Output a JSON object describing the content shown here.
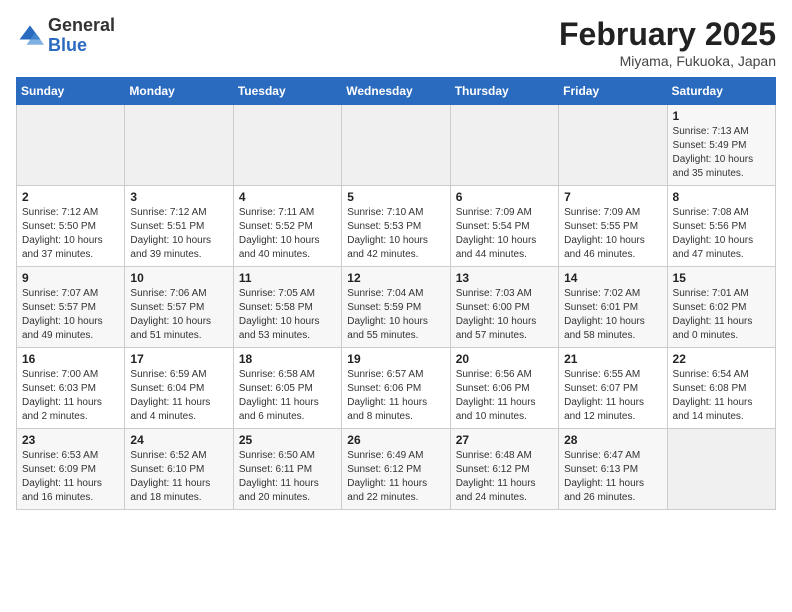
{
  "header": {
    "logo": {
      "general": "General",
      "blue": "Blue"
    },
    "title": "February 2025",
    "location": "Miyama, Fukuoka, Japan"
  },
  "days_of_week": [
    "Sunday",
    "Monday",
    "Tuesday",
    "Wednesday",
    "Thursday",
    "Friday",
    "Saturday"
  ],
  "weeks": [
    [
      {
        "day": null
      },
      {
        "day": null
      },
      {
        "day": null
      },
      {
        "day": null
      },
      {
        "day": null
      },
      {
        "day": null
      },
      {
        "day": 1,
        "sunrise": "7:13 AM",
        "sunset": "5:49 PM",
        "daylight": "10 hours and 35 minutes."
      }
    ],
    [
      {
        "day": 2,
        "sunrise": "7:12 AM",
        "sunset": "5:50 PM",
        "daylight": "10 hours and 37 minutes."
      },
      {
        "day": 3,
        "sunrise": "7:12 AM",
        "sunset": "5:51 PM",
        "daylight": "10 hours and 39 minutes."
      },
      {
        "day": 4,
        "sunrise": "7:11 AM",
        "sunset": "5:52 PM",
        "daylight": "10 hours and 40 minutes."
      },
      {
        "day": 5,
        "sunrise": "7:10 AM",
        "sunset": "5:53 PM",
        "daylight": "10 hours and 42 minutes."
      },
      {
        "day": 6,
        "sunrise": "7:09 AM",
        "sunset": "5:54 PM",
        "daylight": "10 hours and 44 minutes."
      },
      {
        "day": 7,
        "sunrise": "7:09 AM",
        "sunset": "5:55 PM",
        "daylight": "10 hours and 46 minutes."
      },
      {
        "day": 8,
        "sunrise": "7:08 AM",
        "sunset": "5:56 PM",
        "daylight": "10 hours and 47 minutes."
      }
    ],
    [
      {
        "day": 9,
        "sunrise": "7:07 AM",
        "sunset": "5:57 PM",
        "daylight": "10 hours and 49 minutes."
      },
      {
        "day": 10,
        "sunrise": "7:06 AM",
        "sunset": "5:57 PM",
        "daylight": "10 hours and 51 minutes."
      },
      {
        "day": 11,
        "sunrise": "7:05 AM",
        "sunset": "5:58 PM",
        "daylight": "10 hours and 53 minutes."
      },
      {
        "day": 12,
        "sunrise": "7:04 AM",
        "sunset": "5:59 PM",
        "daylight": "10 hours and 55 minutes."
      },
      {
        "day": 13,
        "sunrise": "7:03 AM",
        "sunset": "6:00 PM",
        "daylight": "10 hours and 57 minutes."
      },
      {
        "day": 14,
        "sunrise": "7:02 AM",
        "sunset": "6:01 PM",
        "daylight": "10 hours and 58 minutes."
      },
      {
        "day": 15,
        "sunrise": "7:01 AM",
        "sunset": "6:02 PM",
        "daylight": "11 hours and 0 minutes."
      }
    ],
    [
      {
        "day": 16,
        "sunrise": "7:00 AM",
        "sunset": "6:03 PM",
        "daylight": "11 hours and 2 minutes."
      },
      {
        "day": 17,
        "sunrise": "6:59 AM",
        "sunset": "6:04 PM",
        "daylight": "11 hours and 4 minutes."
      },
      {
        "day": 18,
        "sunrise": "6:58 AM",
        "sunset": "6:05 PM",
        "daylight": "11 hours and 6 minutes."
      },
      {
        "day": 19,
        "sunrise": "6:57 AM",
        "sunset": "6:06 PM",
        "daylight": "11 hours and 8 minutes."
      },
      {
        "day": 20,
        "sunrise": "6:56 AM",
        "sunset": "6:06 PM",
        "daylight": "11 hours and 10 minutes."
      },
      {
        "day": 21,
        "sunrise": "6:55 AM",
        "sunset": "6:07 PM",
        "daylight": "11 hours and 12 minutes."
      },
      {
        "day": 22,
        "sunrise": "6:54 AM",
        "sunset": "6:08 PM",
        "daylight": "11 hours and 14 minutes."
      }
    ],
    [
      {
        "day": 23,
        "sunrise": "6:53 AM",
        "sunset": "6:09 PM",
        "daylight": "11 hours and 16 minutes."
      },
      {
        "day": 24,
        "sunrise": "6:52 AM",
        "sunset": "6:10 PM",
        "daylight": "11 hours and 18 minutes."
      },
      {
        "day": 25,
        "sunrise": "6:50 AM",
        "sunset": "6:11 PM",
        "daylight": "11 hours and 20 minutes."
      },
      {
        "day": 26,
        "sunrise": "6:49 AM",
        "sunset": "6:12 PM",
        "daylight": "11 hours and 22 minutes."
      },
      {
        "day": 27,
        "sunrise": "6:48 AM",
        "sunset": "6:12 PM",
        "daylight": "11 hours and 24 minutes."
      },
      {
        "day": 28,
        "sunrise": "6:47 AM",
        "sunset": "6:13 PM",
        "daylight": "11 hours and 26 minutes."
      },
      {
        "day": null
      }
    ]
  ]
}
